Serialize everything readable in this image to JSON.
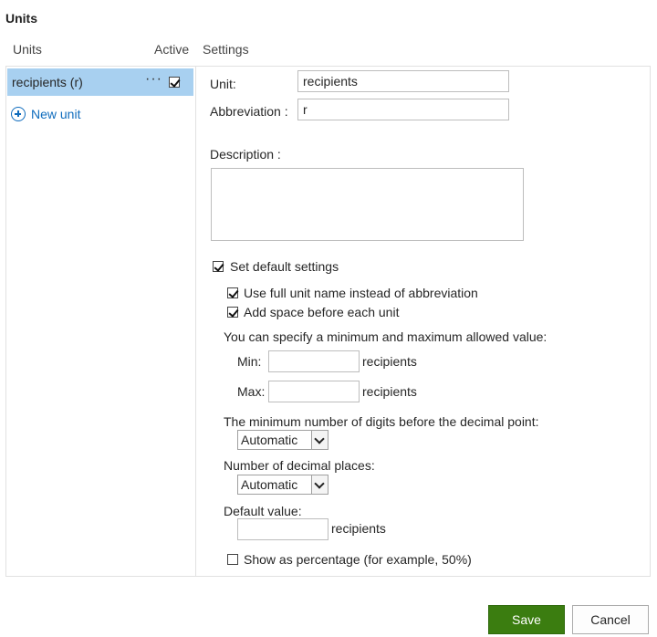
{
  "header": {
    "title": "Units"
  },
  "columns": {
    "units": "Units",
    "active": "Active",
    "settings": "Settings"
  },
  "units_list": {
    "items": [
      {
        "label": "recipients (r)",
        "more": "···",
        "active": true
      }
    ],
    "new_unit_label": "New unit"
  },
  "settings": {
    "unit_label": "Unit:",
    "unit_value": "recipients",
    "abbreviation_label": "Abbreviation :",
    "abbreviation_value": "r",
    "description_label": "Description :",
    "description_value": "",
    "set_default_label": "Set default settings",
    "set_default_checked": true,
    "use_full_name_label": "Use full unit name instead of abbreviation",
    "use_full_name_checked": true,
    "add_space_label": "Add space before each unit",
    "add_space_checked": true,
    "minmax_intro": "You can specify a minimum and maximum allowed value:",
    "min_label": "Min:",
    "min_value": "",
    "min_unit": "recipients",
    "max_label": "Max:",
    "max_value": "",
    "max_unit": "recipients",
    "min_digits_label": "The minimum number of digits before the decimal point:",
    "min_digits_value": "Automatic",
    "decimal_places_label": "Number of decimal places:",
    "decimal_places_value": "Automatic",
    "default_value_label": "Default value:",
    "default_value": "",
    "default_value_unit": "recipients",
    "show_percentage_label": "Show as percentage (for example, 50%)",
    "show_percentage_checked": false
  },
  "footer": {
    "save_label": "Save",
    "cancel_label": "Cancel"
  },
  "colors": {
    "selection": "#a8d0f0",
    "link": "#0f6cbd",
    "save_button": "#3b7d10"
  }
}
